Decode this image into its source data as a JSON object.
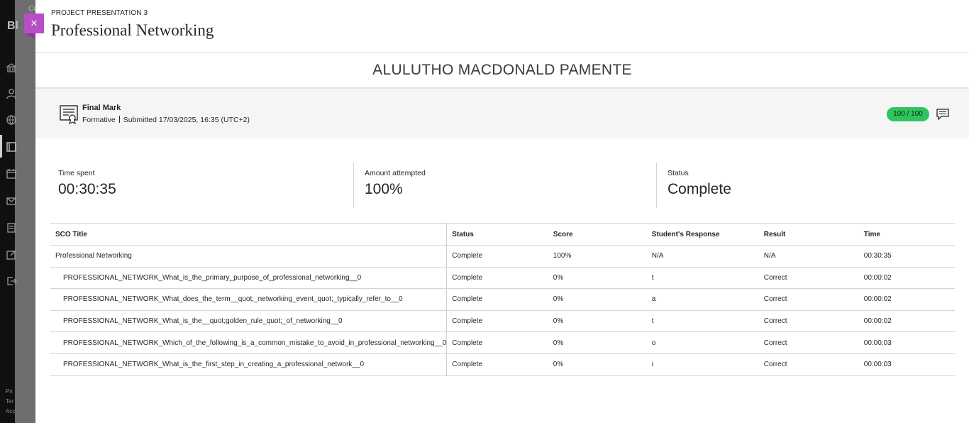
{
  "background": {
    "logo": "Bl",
    "top_text": "Co",
    "footer_lines": [
      "Pri",
      "Ter",
      "Acc"
    ]
  },
  "close_label": "×",
  "header": {
    "kicker": "PROJECT PRESENTATION 3",
    "title": "Professional Networking"
  },
  "student_name": "ALULUTHO MACDONALD PAMENTE",
  "grade": {
    "title": "Final Mark",
    "type": "Formative",
    "submitted": "Submitted 17/03/2025, 16:35 (UTC+2)",
    "score": "100 / 100",
    "score_color": "#2ec45e"
  },
  "stats": {
    "time_spent_label": "Time spent",
    "time_spent": "00:30:35",
    "amount_label": "Amount attempted",
    "amount": "100%",
    "status_label": "Status",
    "status": "Complete"
  },
  "table": {
    "headers": [
      "SCO Title",
      "Status",
      "Score",
      "Student's Response",
      "Result",
      "Time"
    ],
    "rows": [
      [
        "Professional Networking",
        "Complete",
        "100%",
        "N/A",
        "N/A",
        "00:30:35"
      ],
      [
        "PROFESSIONAL_NETWORK_What_is_the_primary_purpose_of_professional_networking__0",
        "Complete",
        "0%",
        "t",
        "Correct",
        "00:00:02"
      ],
      [
        "PROFESSIONAL_NETWORK_What_does_the_term__quot;_networking_event_quot;_typically_refer_to__0",
        "Complete",
        "0%",
        "a",
        "Correct",
        "00:00:02"
      ],
      [
        "PROFESSIONAL_NETWORK_What_is_the__quot;golden_rule_quot;_of_networking__0",
        "Complete",
        "0%",
        "t",
        "Correct",
        "00:00:02"
      ],
      [
        "PROFESSIONAL_NETWORK_Which_of_the_following_is_a_common_mistake_to_avoid_in_professional_networking__0",
        "Complete",
        "0%",
        "o",
        "Correct",
        "00:00:03"
      ],
      [
        "PROFESSIONAL_NETWORK_What_is_the_first_step_in_creating_a_professional_network__0",
        "Complete",
        "0%",
        "i",
        "Correct",
        "00:00:03"
      ]
    ]
  },
  "colors": {
    "accent_close": "#b84fc7",
    "score_pill": "#2ec45e"
  },
  "icons": {
    "close": "close-icon",
    "grade_doc": "certificate-document-icon",
    "comment": "comment-icon"
  }
}
